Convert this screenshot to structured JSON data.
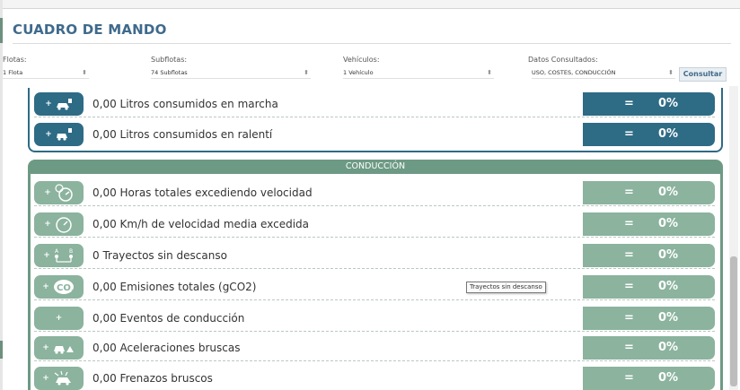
{
  "header": {
    "title": "CUADRO DE MANDO"
  },
  "filters": {
    "flotas": {
      "label": "Flotas:",
      "value": "1 Flota"
    },
    "subflotas": {
      "label": "Subflotas:",
      "value": "74 Subflotas"
    },
    "vehiculos": {
      "label": "Vehículos:",
      "value": "1 Vehículo"
    },
    "datos": {
      "label": "Datos Consultados:",
      "value": "USO, COSTES, CONDUCCIÓN"
    },
    "consultar_label": "Consultar"
  },
  "consumo_rows": [
    {
      "icon": "car-fuel-icon",
      "text": "0,00 Litros consumidos en marcha",
      "eq": "=",
      "pct": "0%"
    },
    {
      "icon": "car-idle-fuel-icon",
      "text": "0,00 Litros consumidos en ralentí",
      "eq": "=",
      "pct": "0%"
    }
  ],
  "conduccion": {
    "title": "CONDUCCIÓN",
    "rows": [
      {
        "icon": "speedometer-clock-icon",
        "text": "0,00 Horas totales excediendo velocidad",
        "eq": "=",
        "pct": "0%"
      },
      {
        "icon": "speedometer-icon",
        "text": "0,00 Km/h de velocidad media excedida",
        "eq": "=",
        "pct": "0%"
      },
      {
        "icon": "route-no-rest-icon",
        "text": "0 Trayectos sin descanso",
        "eq": "=",
        "pct": "0%"
      },
      {
        "icon": "co2-icon",
        "text": "0,00 Emisiones totales (gCO2)",
        "eq": "=",
        "pct": "0%"
      },
      {
        "icon": "",
        "text": "0,00 Eventos de conducción",
        "eq": "=",
        "pct": "0%"
      },
      {
        "icon": "harsh-acceleration-icon",
        "text": "0,00 Aceleraciones bruscas",
        "eq": "=",
        "pct": "0%"
      },
      {
        "icon": "harsh-braking-icon",
        "text": "0,00 Frenazos bruscos",
        "eq": "=",
        "pct": "0%"
      }
    ]
  },
  "tooltip": {
    "text": "Trayectos sin descanso"
  },
  "colors": {
    "blue": "#2e6b85",
    "green": "#8bb39e",
    "green_dark": "#6d9a84",
    "title": "#3f6a8c"
  }
}
